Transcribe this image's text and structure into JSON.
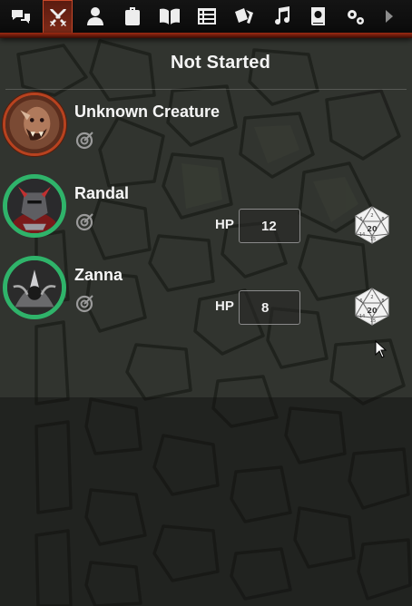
{
  "tabs": [
    {
      "name": "chat",
      "icon": "chat-bubbles-icon",
      "active": false
    },
    {
      "name": "combat",
      "icon": "crossed-swords-icon",
      "active": true
    },
    {
      "name": "actors",
      "icon": "person-icon",
      "active": false
    },
    {
      "name": "items",
      "icon": "backpack-icon",
      "active": false
    },
    {
      "name": "journal",
      "icon": "open-book-icon",
      "active": false
    },
    {
      "name": "tables",
      "icon": "list-icon",
      "active": false
    },
    {
      "name": "cards",
      "icon": "playing-cards-icon",
      "active": false
    },
    {
      "name": "playlists",
      "icon": "music-note-icon",
      "active": false
    },
    {
      "name": "compendium",
      "icon": "atlas-icon",
      "active": false
    },
    {
      "name": "settings",
      "icon": "gears-icon",
      "active": false
    },
    {
      "name": "collapse",
      "icon": "caret-right-icon",
      "active": false
    }
  ],
  "encounter": {
    "status": "Not Started"
  },
  "combatants": [
    {
      "name": "Unknown Creature",
      "hp_label": "",
      "hp": "",
      "ring": "red",
      "show_hp": false,
      "show_die": false
    },
    {
      "name": "Randal",
      "hp_label": "HP",
      "hp": "12",
      "ring": "green",
      "show_hp": true,
      "show_die": true
    },
    {
      "name": "Zanna",
      "hp_label": "HP",
      "hp": "8",
      "ring": "green",
      "show_hp": true,
      "show_die": true
    }
  ],
  "die": {
    "face": "20",
    "small_faces": [
      "6",
      "2",
      "8",
      "14",
      "15"
    ]
  },
  "colors": {
    "accent": "#c8492a",
    "ring_green": "#2fb36a",
    "ring_red": "#b8421f"
  }
}
